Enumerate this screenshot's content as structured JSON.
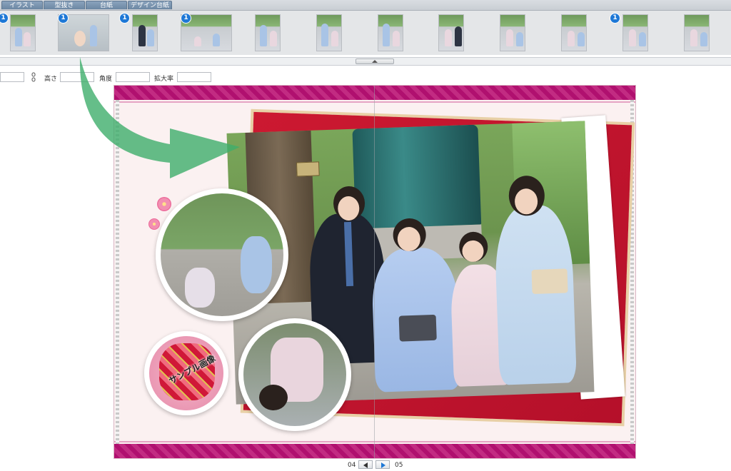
{
  "tabs": [
    {
      "label": "イラスト"
    },
    {
      "label": "型抜き"
    },
    {
      "label": "台紙"
    },
    {
      "label": "デザイン台紙"
    }
  ],
  "thumbnails": [
    {
      "badge": "1"
    },
    {
      "badge": "1"
    },
    {
      "badge": "1"
    },
    {
      "badge": "1"
    },
    {
      "badge": ""
    },
    {
      "badge": ""
    },
    {
      "badge": ""
    },
    {
      "badge": ""
    },
    {
      "badge": ""
    },
    {
      "badge": ""
    },
    {
      "badge": "1"
    },
    {
      "badge": ""
    }
  ],
  "properties": {
    "height_label": "高さ",
    "angle_label": "角度",
    "zoom_label": "拡大率",
    "height_value": "",
    "angle_value": "",
    "zoom_value": "",
    "width_value": ""
  },
  "canvas": {
    "sample_label": "サンプル画像",
    "colors": {
      "band": "#b0106f",
      "frame": "#cc1931",
      "arrow": "#3fae6b"
    }
  },
  "pager": {
    "left_page": "04",
    "right_page": "05"
  }
}
